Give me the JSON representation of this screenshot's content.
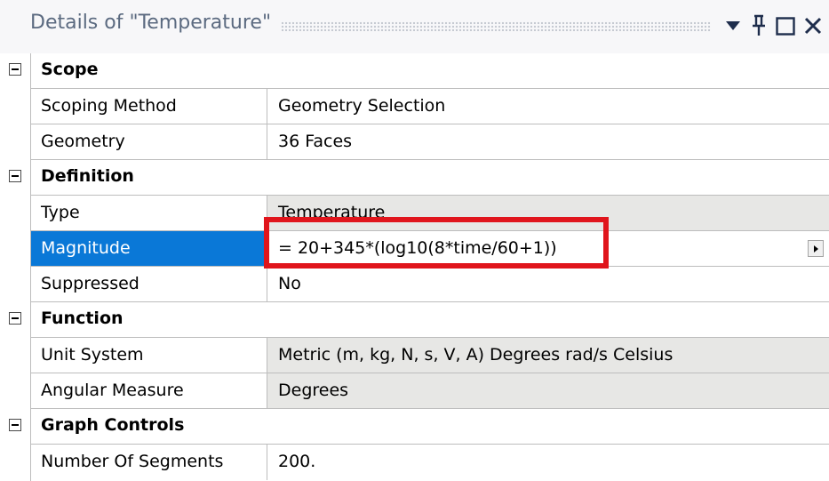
{
  "window": {
    "title": "Details of \"Temperature\"",
    "buttons": {
      "dropdown": "▼",
      "pin": "pin-icon",
      "maximize": "maximize-icon",
      "close": "close-icon"
    }
  },
  "categories": [
    {
      "label": "Scope"
    },
    {
      "label": "Definition"
    },
    {
      "label": "Function"
    },
    {
      "label": "Graph Controls"
    }
  ],
  "scope": {
    "scoping_method": {
      "name": "Scoping Method",
      "value": "Geometry Selection"
    },
    "geometry": {
      "name": "Geometry",
      "value": "36 Faces"
    }
  },
  "definition": {
    "type": {
      "name": "Type",
      "value": "Temperature"
    },
    "magnitude": {
      "name": "Magnitude",
      "value": "= 20+345*(log10(8*time/60+1))"
    },
    "suppressed": {
      "name": "Suppressed",
      "value": "No"
    }
  },
  "function": {
    "unit_system": {
      "name": "Unit System",
      "value": "Metric (m, kg, N, s, V, A)  Degrees  rad/s  Celsius"
    },
    "angular_measure": {
      "name": "Angular Measure",
      "value": "Degrees"
    }
  },
  "graph_controls": {
    "number_of_segments": {
      "name": "Number Of Segments",
      "value": "200."
    }
  },
  "colors": {
    "selection": "#0a78d7",
    "readonly_bg": "#e7e7e5",
    "highlight": "#e0151c",
    "title_text": "#5b6a80"
  }
}
